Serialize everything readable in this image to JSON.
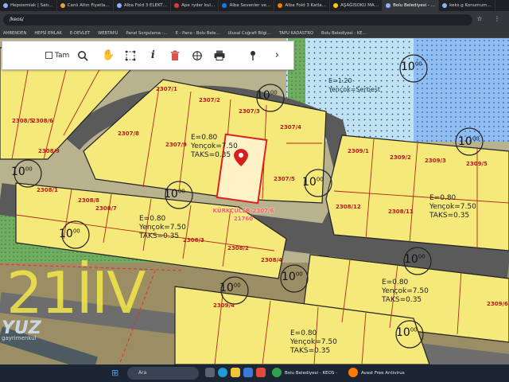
{
  "browser": {
    "tabs": [
      "Hepsiemlak | Satı…",
      "Canlı Altın Fiyatla…",
      "Alba Fold 3 ELEKT…",
      "Ape ryder kul…",
      "Alba Sevenler ve…",
      "Alba Fold 3 Katla…",
      "AŞAĞISOKU MA…",
      "Bolu Belediyesi - …",
      "keks.g Konumum…"
    ],
    "active_tab": "Bolu Belediyesi - …",
    "url": "/keos/",
    "bookmarks": [
      "AHBENDEN",
      "HEPSİ EMLAK",
      "E-DEVLET",
      "WEBTAPU",
      "Panel Sorgulama -…",
      "E - Pano - Bolu Bele…",
      "Ulusal Coğrafi Bilgi…",
      "TAPU KADASTRO",
      "Bolu Belediyesi - KE…"
    ]
  },
  "toolbar": {
    "checkbox_label": "Tam",
    "checkbox_checked": false,
    "icons": [
      "zoom-icon",
      "hand-icon",
      "select-icon",
      "info-icon",
      "delete-icon",
      "measure-icon",
      "print-icon",
      "pin-icon",
      "next-icon"
    ]
  },
  "map": {
    "parcels": [
      "2307/1",
      "2307/2",
      "2307/3",
      "2307/4",
      "2307/5",
      "2307/6",
      "2307/7",
      "2307/8",
      "2307/9",
      "2308/1",
      "2308/2",
      "2308/3",
      "2308/4",
      "2308/5",
      "2308/6",
      "2308/7",
      "2308/8",
      "2308/9",
      "2308/11",
      "2308/12",
      "2309/1",
      "2309/2",
      "2309/3",
      "2309/4",
      "2309/5",
      "2309/6"
    ],
    "road_width": "10",
    "road_width_sup": "00",
    "zoning": {
      "e": "E=0.80",
      "yencok": "Yençok=7.50",
      "taks": "TAKS=0.35"
    },
    "zoning_blue": {
      "e": "E=1.20",
      "yencok": "Yençok=Serbest"
    },
    "selected_label": "KÜRKÇÜLER-2307/6",
    "selected_area": "21760",
    "sheet_label": "21İIV",
    "watermark": "YUZ",
    "watermark_sub": "gayrimenkul"
  },
  "taskbar": {
    "search_placeholder": "Ara",
    "apps": [
      "Bolu Belediyesi - KEOS -",
      "Avast Free Antivirus"
    ]
  }
}
